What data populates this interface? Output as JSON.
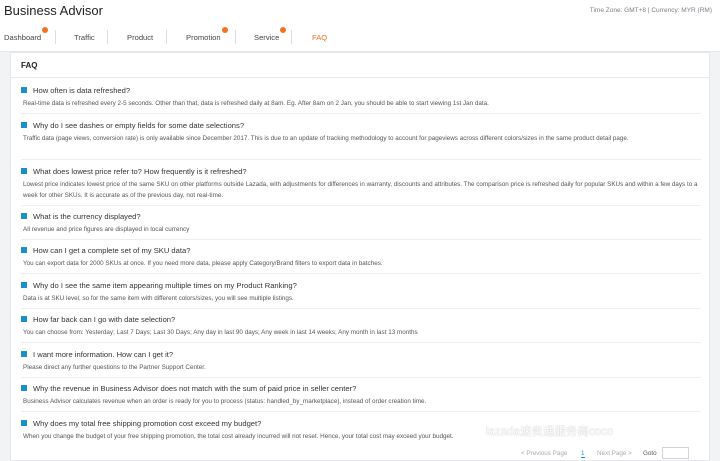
{
  "header": {
    "title": "Business Advisor",
    "meta": "Time Zone: GMT+8 | Currency: MYR (RM)"
  },
  "nav": {
    "items": [
      {
        "label": "Dashboard",
        "badge": true,
        "active": false
      },
      {
        "label": "Traffic",
        "badge": false,
        "active": false
      },
      {
        "label": "Product",
        "badge": false,
        "active": false
      },
      {
        "label": "Promotion",
        "badge": true,
        "active": false
      },
      {
        "label": "Service",
        "badge": true,
        "active": false
      },
      {
        "label": "FAQ",
        "badge": false,
        "active": true
      }
    ]
  },
  "faq": {
    "heading": "FAQ",
    "items": [
      {
        "q": "How often is data refreshed?",
        "a": "Real-time data is refreshed every 2-5 seconds. Other than that, data is refreshed daily at 8am. Eg. After 8am on 2 Jan, you should be able to start viewing 1st Jan data."
      },
      {
        "q": "Why do I see dashes or empty fields for some date selections?",
        "a": "Traffic data (page views, conversion rate) is only available since December 2017. This is due to an update of tracking methodology to account for pageviews across different colors/sizes in the same product detail page."
      },
      {
        "q": "What does lowest price refer to? How frequently is it refreshed?",
        "a": "Lowest price indicates lowest price of the same SKU on other platforms outside Lazada, with adjustments for differences in warranty, discounts and attributes. The comparison price is refreshed daily for popular SKUs and within a few days to a week for other SKUs. It is accurate as of the previous day, not real-time."
      },
      {
        "q": "What is the currency displayed?",
        "a": "All revenue and price figures are displayed in local currency"
      },
      {
        "q": "How can I get a complete set of my SKU data?",
        "a": "You can export data for 2000 SKUs at once. If you need more data, please apply Category/Brand filters to export data in batches."
      },
      {
        "q": "Why do I see the same item appearing multiple times on my Product Ranking?",
        "a": "Data is at SKU level, so for the same item with different colors/sizes, you will see multiple listings."
      },
      {
        "q": "How far back can I go with date selection?",
        "a": "You can choose from: Yesterday; Last 7 Days; Last 30 Days; Any day in last 90 days; Any week in last 14 weeks; Any month in last 13 months"
      },
      {
        "q": "I want more information. How can I get it?",
        "a": "Please direct any further questions to the Partner Support Center."
      },
      {
        "q": "Why the revenue in Business Advisor does not match with the sum of paid price in seller center?",
        "a": "Business Advisor calculates revenue when an order is ready for you to process (status: handled_by_marketplace), instead of order creation time."
      },
      {
        "q": "Why does my total free shipping promotion cost exceed my budget?",
        "a": "When you change the budget of your free shipping promotion, the total cost already incurred will not reset. Hence, your total cost may exceed your budget."
      }
    ]
  },
  "pager": {
    "prev": "< Previous Page",
    "current": "1",
    "next": "Next Page >",
    "goto": "Goto"
  },
  "watermark": {
    "text": "lazada速卖通服务商coco",
    "icon": "chat-bubble-icon"
  },
  "colors": {
    "accent": "#f57224",
    "question_marker": "#1a8fd0",
    "panel_bg": "#ffffff",
    "page_bg": "#f2f3f5"
  }
}
